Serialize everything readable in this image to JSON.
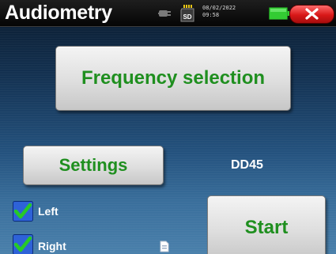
{
  "header": {
    "title": "Audiometry",
    "date": "08/02/2022",
    "time": "09:58",
    "sd_label": "SD",
    "icons": {
      "power": "plug-icon",
      "storage": "sd-card-icon",
      "battery": "battery-icon",
      "close": "close-icon"
    }
  },
  "main": {
    "frequency_button_label": "Frequency selection",
    "settings_button_label": "Settings",
    "device_name": "DD45",
    "start_button_label": "Start",
    "ears": [
      {
        "label": "Left",
        "checked": true
      },
      {
        "label": "Right",
        "checked": true
      }
    ],
    "file_icon": "file-icon"
  },
  "colors": {
    "accent_green": "#1f8f1f",
    "check_blue": "#2e62d8",
    "check_green": "#27c927",
    "close_red": "#d81818",
    "battery_green": "#33cc33",
    "background_top": "#0a1a2c",
    "background_bottom": "#4a80ab"
  }
}
